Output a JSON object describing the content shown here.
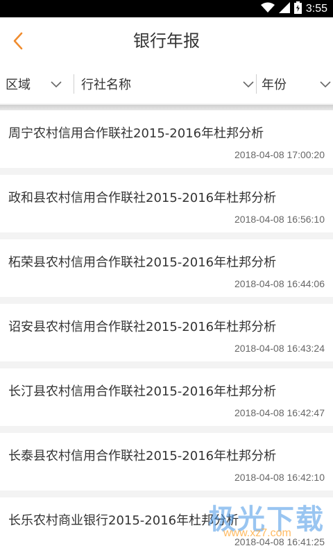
{
  "status_bar": {
    "time": "3:55"
  },
  "header": {
    "title": "银行年报",
    "back_icon": "chevron-left-icon",
    "accent": "#f08c2e"
  },
  "filters": [
    {
      "label": "区域",
      "icon": "chevron-down-icon"
    },
    {
      "label": "行社名称",
      "icon": "chevron-down-icon"
    },
    {
      "label": "年份",
      "icon": "chevron-down-icon"
    }
  ],
  "reports": [
    {
      "title": "周宁农村信用合作联社2015-2016年杜邦分析",
      "time": "2018-04-08 17:00:20"
    },
    {
      "title": "政和县农村信用合作联社2015-2016年杜邦分析",
      "time": "2018-04-08 16:56:10"
    },
    {
      "title": "柘荣县农村信用合作联社2015-2016年杜邦分析",
      "time": "2018-04-08 16:44:06"
    },
    {
      "title": "诏安县农村信用合作联社2015-2016年杜邦分析",
      "time": "2018-04-08 16:43:24"
    },
    {
      "title": "长汀县农村信用合作联社2015-2016年杜邦分析",
      "time": "2018-04-08 16:42:47"
    },
    {
      "title": "长泰县农村信用合作联社2015-2016年杜邦分析",
      "time": "2018-04-08 16:42:10"
    },
    {
      "title": "长乐农村商业银行2015-2016年杜邦分析",
      "time": "2018-04-08 16:41:25"
    }
  ],
  "watermark": {
    "text": "极光下载",
    "url": "www.xz7.com"
  }
}
